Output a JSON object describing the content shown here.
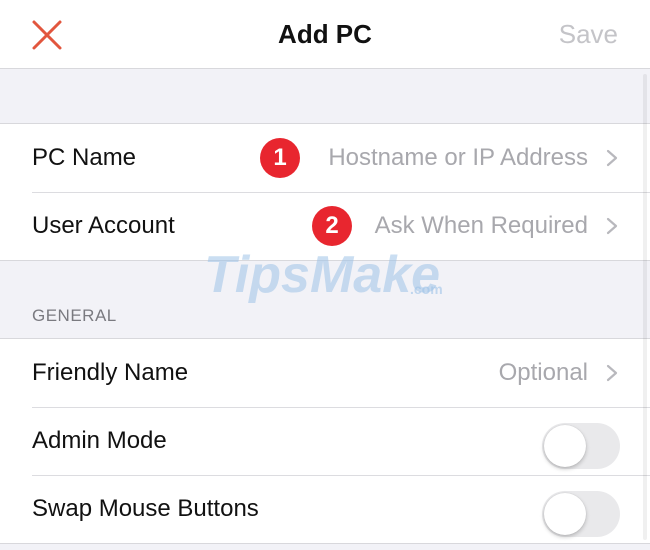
{
  "nav": {
    "title": "Add PC",
    "save_label": "Save",
    "close_icon": "close-icon"
  },
  "connection": {
    "rows": [
      {
        "label": "PC Name",
        "value": "Hostname or IP Address",
        "badge": "1"
      },
      {
        "label": "User Account",
        "value": "Ask When Required",
        "badge": "2"
      }
    ]
  },
  "general": {
    "header": "GENERAL",
    "friendly_name": {
      "label": "Friendly Name",
      "value": "Optional"
    },
    "admin_mode": {
      "label": "Admin Mode",
      "enabled": false
    },
    "swap_mouse": {
      "label": "Swap Mouse Buttons",
      "enabled": false
    }
  },
  "watermark": {
    "brand": "TipsMake",
    "suffix": ".com"
  },
  "colors": {
    "accent": "#e8262f",
    "close_icon": "#e2563e",
    "placeholder": "#a8a8ad",
    "disabled_action": "#c4c4c8",
    "toggle_off": "#e9e9eb",
    "background": "#f2f2f7"
  }
}
